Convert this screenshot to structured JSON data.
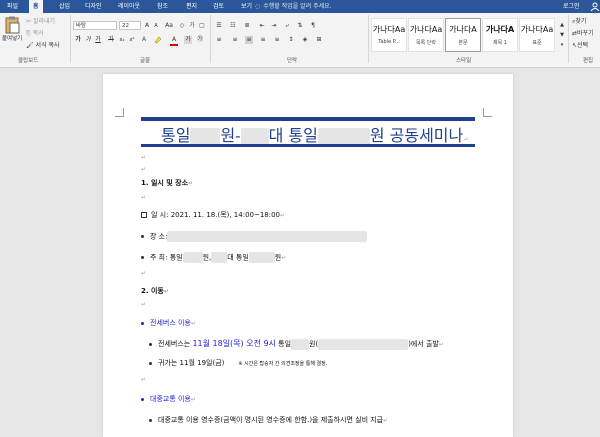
{
  "ribbon": {
    "tabs": [
      "파일",
      "홈",
      "삽입",
      "디자인",
      "레이아웃",
      "참조",
      "편지",
      "검토",
      "보기"
    ],
    "tell_me": "수행할 작업을 알려 주세요.",
    "login": "로그인",
    "clipboard": {
      "paste": "붙여넣기",
      "cut": "잘라내기",
      "copy": "복사",
      "format_painter": "서식 복사",
      "label": "클립보드"
    },
    "font": {
      "name": "바탕",
      "size": "22",
      "label": "글꼴",
      "grow": "A",
      "shrink": "A",
      "case": "Aa",
      "bold": "가",
      "italic": "가",
      "underline": "가",
      "strike": "가",
      "subscript": "x₂",
      "superscript": "x²",
      "color_a": "A"
    },
    "paragraph": {
      "label": "단락"
    },
    "styles": {
      "label": "스타일",
      "items": [
        {
          "sample": "가나다Aa",
          "name": "Table P..."
        },
        {
          "sample": "가나다Aa",
          "name": "목록 단락"
        },
        {
          "sample": "가나다A",
          "name": "본문"
        },
        {
          "sample": "가나다A",
          "name": "제목 1"
        },
        {
          "sample": "가나다Aa",
          "name": "표준"
        }
      ]
    },
    "editing": {
      "find": "찾기",
      "replace": "바꾸기",
      "select": "선택",
      "label": "편집"
    }
  },
  "document": {
    "title_parts": [
      "통일",
      "원-",
      "대 통일",
      "원 공동세미나"
    ],
    "section1": "1. 일시 및 장소",
    "when_label": "일      시",
    "when_value": ": 2021. 11. 18.(목), 14:00~18:00",
    "where_label": "장      소",
    "where_value": ":",
    "host_label": "주      최",
    "host_parts": [
      ": 통일",
      "원,",
      "대 통일",
      "원"
    ],
    "section2": "2. 이동",
    "bus_heading": "전세버스 이용",
    "bus_line_parts": [
      "전세버스는 ",
      "11월 18일(목) 오전 9시",
      " 통일",
      "원(",
      ")에서 출발"
    ],
    "return_line": "귀가는 11월 19일(금)",
    "return_note": "※ 시간은 탑승자 간 의견조정을 통해 결정.",
    "transit_heading": "대중교통 이용",
    "transit_line": "대중교통 이용 영수증(금액이 명시된 영수증에 한함.)을 제출하시면 실비 지급"
  }
}
